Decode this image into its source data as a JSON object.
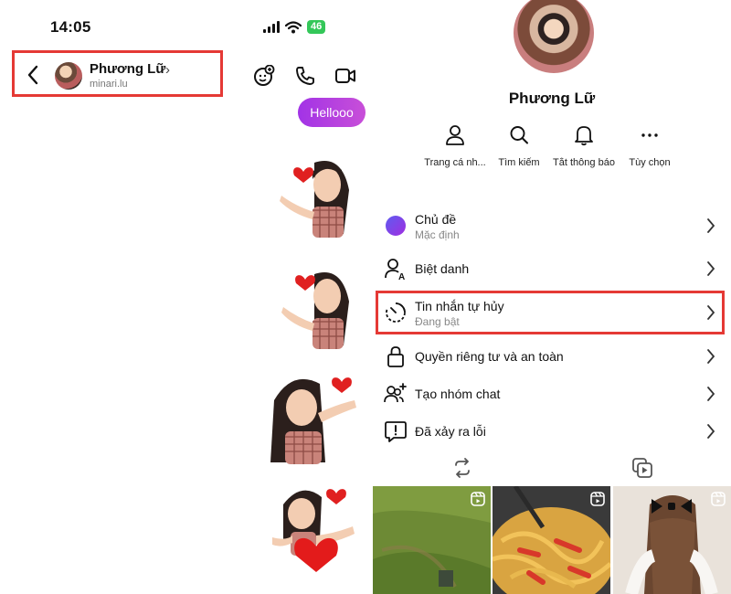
{
  "status_bar": {
    "time": "14:05",
    "battery": "46"
  },
  "chat_header": {
    "contact_name": "Phương Lữ",
    "handle": "minari.lu"
  },
  "messages": [
    {
      "text": "Hellooo"
    }
  ],
  "details": {
    "profile_name": "Phương Lữ",
    "actions": [
      {
        "label": "Trang cá nh...",
        "icon": "profile-icon"
      },
      {
        "label": "Tìm kiếm",
        "icon": "search-icon"
      },
      {
        "label": "Tắt thông báo",
        "icon": "bell-icon"
      },
      {
        "label": "Tùy chọn",
        "icon": "more-icon"
      }
    ],
    "settings": {
      "theme": {
        "title": "Chủ đề",
        "subtitle": "Mặc định"
      },
      "nickname": {
        "title": "Biệt danh"
      },
      "vanish": {
        "title": "Tin nhắn tự hủy",
        "subtitle": "Đang bật"
      },
      "privacy": {
        "title": "Quyền riêng tư và an toàn"
      },
      "group": {
        "title": "Tạo nhóm chat"
      },
      "report": {
        "title": "Đã xảy ra lỗi"
      }
    }
  },
  "colors": {
    "accent_purple": "#a233e6",
    "highlight_red": "#e53935",
    "theme_dot": "#6b4df0"
  }
}
